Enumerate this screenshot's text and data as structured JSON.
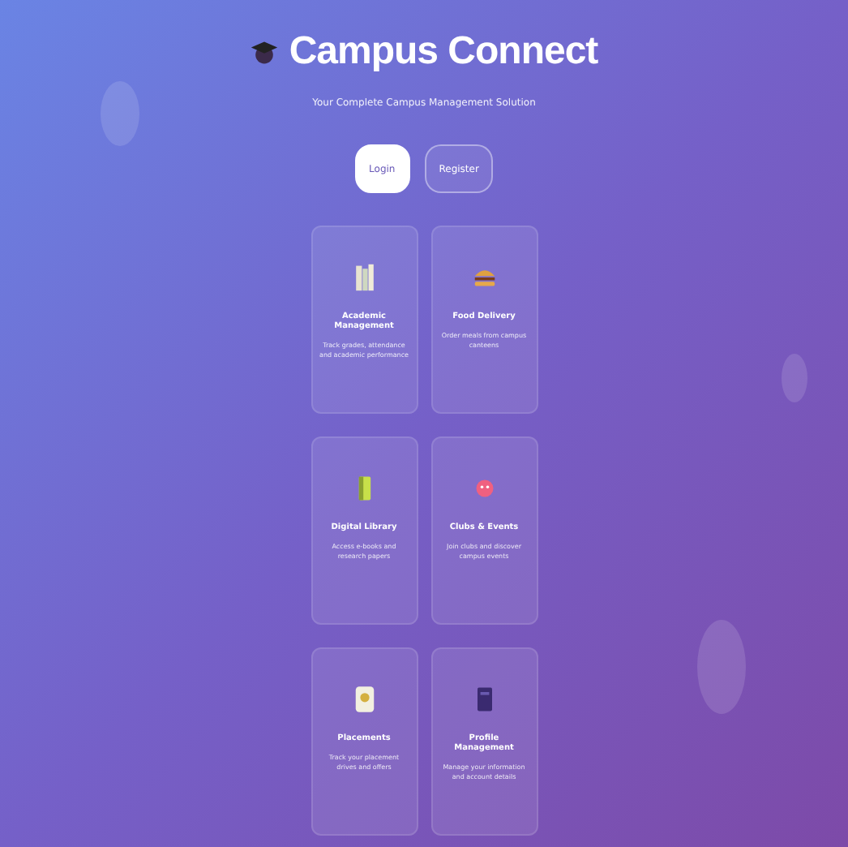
{
  "header": {
    "title": "Campus Connect",
    "subtitle": "Your Complete Campus Management Solution"
  },
  "auth_buttons": [
    {
      "label": "Login",
      "selected": true
    },
    {
      "label": "Register",
      "selected": false
    }
  ],
  "features": [
    {
      "title": "Academic Management",
      "description": "Track grades, attendance and academic performance"
    },
    {
      "title": "Food Delivery",
      "description": "Order meals from campus canteens"
    },
    {
      "title": "Digital Library",
      "description": "Access e-books and research papers"
    },
    {
      "title": "Clubs & Events",
      "description": "Join clubs and discover campus events"
    },
    {
      "title": "Placements",
      "description": "Track your placement drives and offers"
    },
    {
      "title": "Profile Management",
      "description": "Manage your information and account details"
    }
  ]
}
